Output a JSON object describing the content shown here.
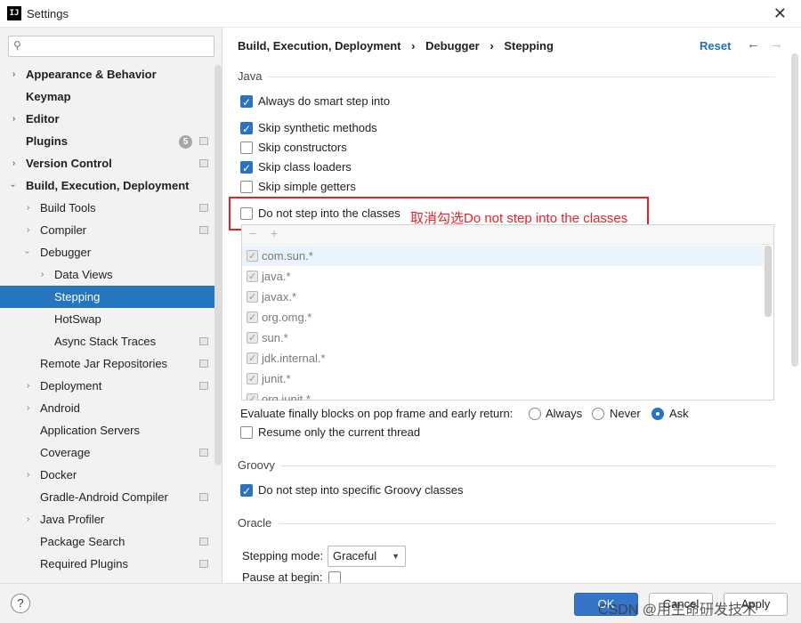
{
  "window": {
    "title": "Settings",
    "app_icon_text": "IJ"
  },
  "search": {
    "placeholder": "",
    "value": ""
  },
  "sidebar": {
    "items": [
      {
        "label": "Appearance & Behavior"
      },
      {
        "label": "Keymap"
      },
      {
        "label": "Editor"
      },
      {
        "label": "Plugins",
        "badge": "5"
      },
      {
        "label": "Version Control"
      },
      {
        "label": "Build, Execution, Deployment"
      },
      {
        "label": "Build Tools"
      },
      {
        "label": "Compiler"
      },
      {
        "label": "Debugger"
      },
      {
        "label": "Data Views"
      },
      {
        "label": "Stepping"
      },
      {
        "label": "HotSwap"
      },
      {
        "label": "Async Stack Traces"
      },
      {
        "label": "Remote Jar Repositories"
      },
      {
        "label": "Deployment"
      },
      {
        "label": "Android"
      },
      {
        "label": "Application Servers"
      },
      {
        "label": "Coverage"
      },
      {
        "label": "Docker"
      },
      {
        "label": "Gradle-Android Compiler"
      },
      {
        "label": "Java Profiler"
      },
      {
        "label": "Package Search"
      },
      {
        "label": "Required Plugins"
      }
    ]
  },
  "header": {
    "crumbs": [
      "Build, Execution, Deployment",
      "Debugger",
      "Stepping"
    ],
    "separator": "›",
    "reset_label": "Reset"
  },
  "java": {
    "section_title": "Java",
    "always_smart_step": {
      "label": "Always do smart step into",
      "checked": true
    },
    "skip_synthetic": {
      "label": "Skip synthetic methods",
      "checked": true
    },
    "skip_constructors": {
      "label": "Skip constructors",
      "checked": false
    },
    "skip_class_loaders": {
      "label": "Skip class loaders",
      "checked": true
    },
    "skip_simple_getters": {
      "label": "Skip simple getters",
      "checked": false
    },
    "do_not_step_classes": {
      "label": "Do not step into the classes",
      "checked": false
    },
    "annotation": "取消勾选Do not step into the classes",
    "class_filters": [
      "com.sun.*",
      "java.*",
      "javax.*",
      "org.omg.*",
      "sun.*",
      "jdk.internal.*",
      "junit.*",
      "org.junit.*"
    ],
    "evaluate_finally_label": "Evaluate finally blocks on pop frame and early return:",
    "evaluate_options": [
      "Always",
      "Never",
      "Ask"
    ],
    "evaluate_selected": "Ask",
    "resume_only_current": {
      "label": "Resume only the current thread",
      "checked": false
    }
  },
  "groovy": {
    "section_title": "Groovy",
    "do_not_step_groovy": {
      "label": "Do not step into specific Groovy classes",
      "checked": true
    }
  },
  "oracle": {
    "section_title": "Oracle",
    "stepping_mode_label": "Stepping mode:",
    "stepping_mode_value": "Graceful",
    "pause_at_begin_label": "Pause at begin:"
  },
  "footer": {
    "help_label": "?",
    "ok_label": "OK",
    "cancel_label": "Cancel",
    "apply_label": "Apply",
    "watermark": "CSDN @用生命研发技术"
  },
  "colors": {
    "accent": "#2a73c4",
    "selection": "#2675bf",
    "annotation": "#e5232b"
  }
}
